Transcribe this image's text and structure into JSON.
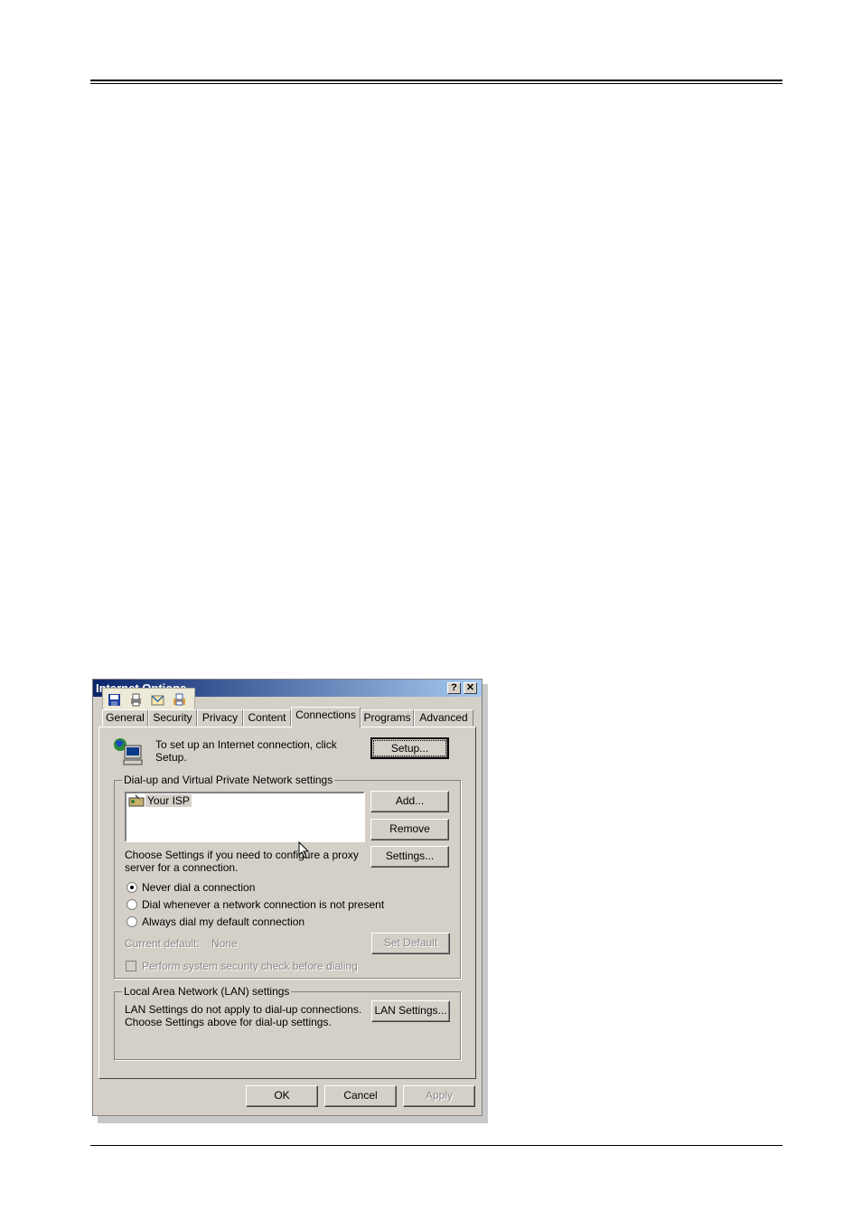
{
  "dialog": {
    "title": "Internet Options",
    "help_btn": "?",
    "close_btn": "✕"
  },
  "tabs": [
    {
      "label": "General",
      "active": false
    },
    {
      "label": "Security",
      "active": false
    },
    {
      "label": "Privacy",
      "active": false
    },
    {
      "label": "Content",
      "active": false
    },
    {
      "label": "Connections",
      "active": true
    },
    {
      "label": "Programs",
      "active": false
    },
    {
      "label": "Advanced",
      "active": false
    }
  ],
  "setup": {
    "text_line1": "To set up an Internet connection, click",
    "text_line2": "Setup.",
    "button": "Setup..."
  },
  "dialup": {
    "legend": "Dial-up and Virtual Private Network settings",
    "list_items": [
      "Your ISP"
    ],
    "add_button": "Add...",
    "remove_button": "Remove",
    "settings_text_line1": "Choose Settings if you need to configure a proxy",
    "settings_text_line2": "server for a connection.",
    "settings_button": "Settings...",
    "radio_never": "Never dial a connection",
    "radio_whenever": "Dial whenever a network connection is not present",
    "radio_always": "Always dial my default connection",
    "selected_radio": "never",
    "current_default_label": "Current default:",
    "current_default_value": "None",
    "set_default_button": "Set Default",
    "security_check_label": "Perform system security check before dialing"
  },
  "lan": {
    "legend": "Local Area Network (LAN) settings",
    "text_line1": "LAN Settings do not apply to dial-up connections.",
    "text_line2": "Choose Settings above for dial-up settings.",
    "button": "LAN Settings..."
  },
  "footer": {
    "ok": "OK",
    "cancel": "Cancel",
    "apply": "Apply"
  },
  "icons": {
    "toolbar": [
      "save-icon",
      "print-icon",
      "mail-icon",
      "printer-icon"
    ],
    "connection": "globe-computer-icon",
    "isp": "modem-icon"
  }
}
